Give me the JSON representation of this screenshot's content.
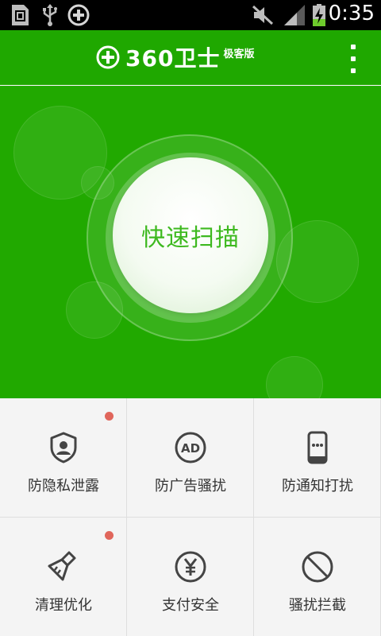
{
  "status_bar": {
    "time": "0:35",
    "icons": [
      "sd-card-icon",
      "usb-icon",
      "360-shield-icon",
      "mute-icon",
      "signal-icon",
      "battery-charging-icon"
    ]
  },
  "header": {
    "logo_text": "360卫士",
    "logo_sub": "极客版",
    "menu_icon": "more-vertical-icon"
  },
  "hero": {
    "scan_label": "快速扫描"
  },
  "features": [
    {
      "label": "防隐私泄露",
      "icon": "privacy-shield-icon",
      "badge": true
    },
    {
      "label": "防广告骚扰",
      "icon": "ad-icon",
      "badge": false
    },
    {
      "label": "防通知打扰",
      "icon": "phone-notification-icon",
      "badge": false
    },
    {
      "label": "清理优化",
      "icon": "broom-icon",
      "badge": true
    },
    {
      "label": "支付安全",
      "icon": "yen-icon",
      "badge": false
    },
    {
      "label": "骚扰拦截",
      "icon": "block-icon",
      "badge": false
    }
  ],
  "colors": {
    "brand_green": "#21a900",
    "scan_text": "#3db91f",
    "badge_red": "#e0665b",
    "icon_gray": "#444444"
  }
}
